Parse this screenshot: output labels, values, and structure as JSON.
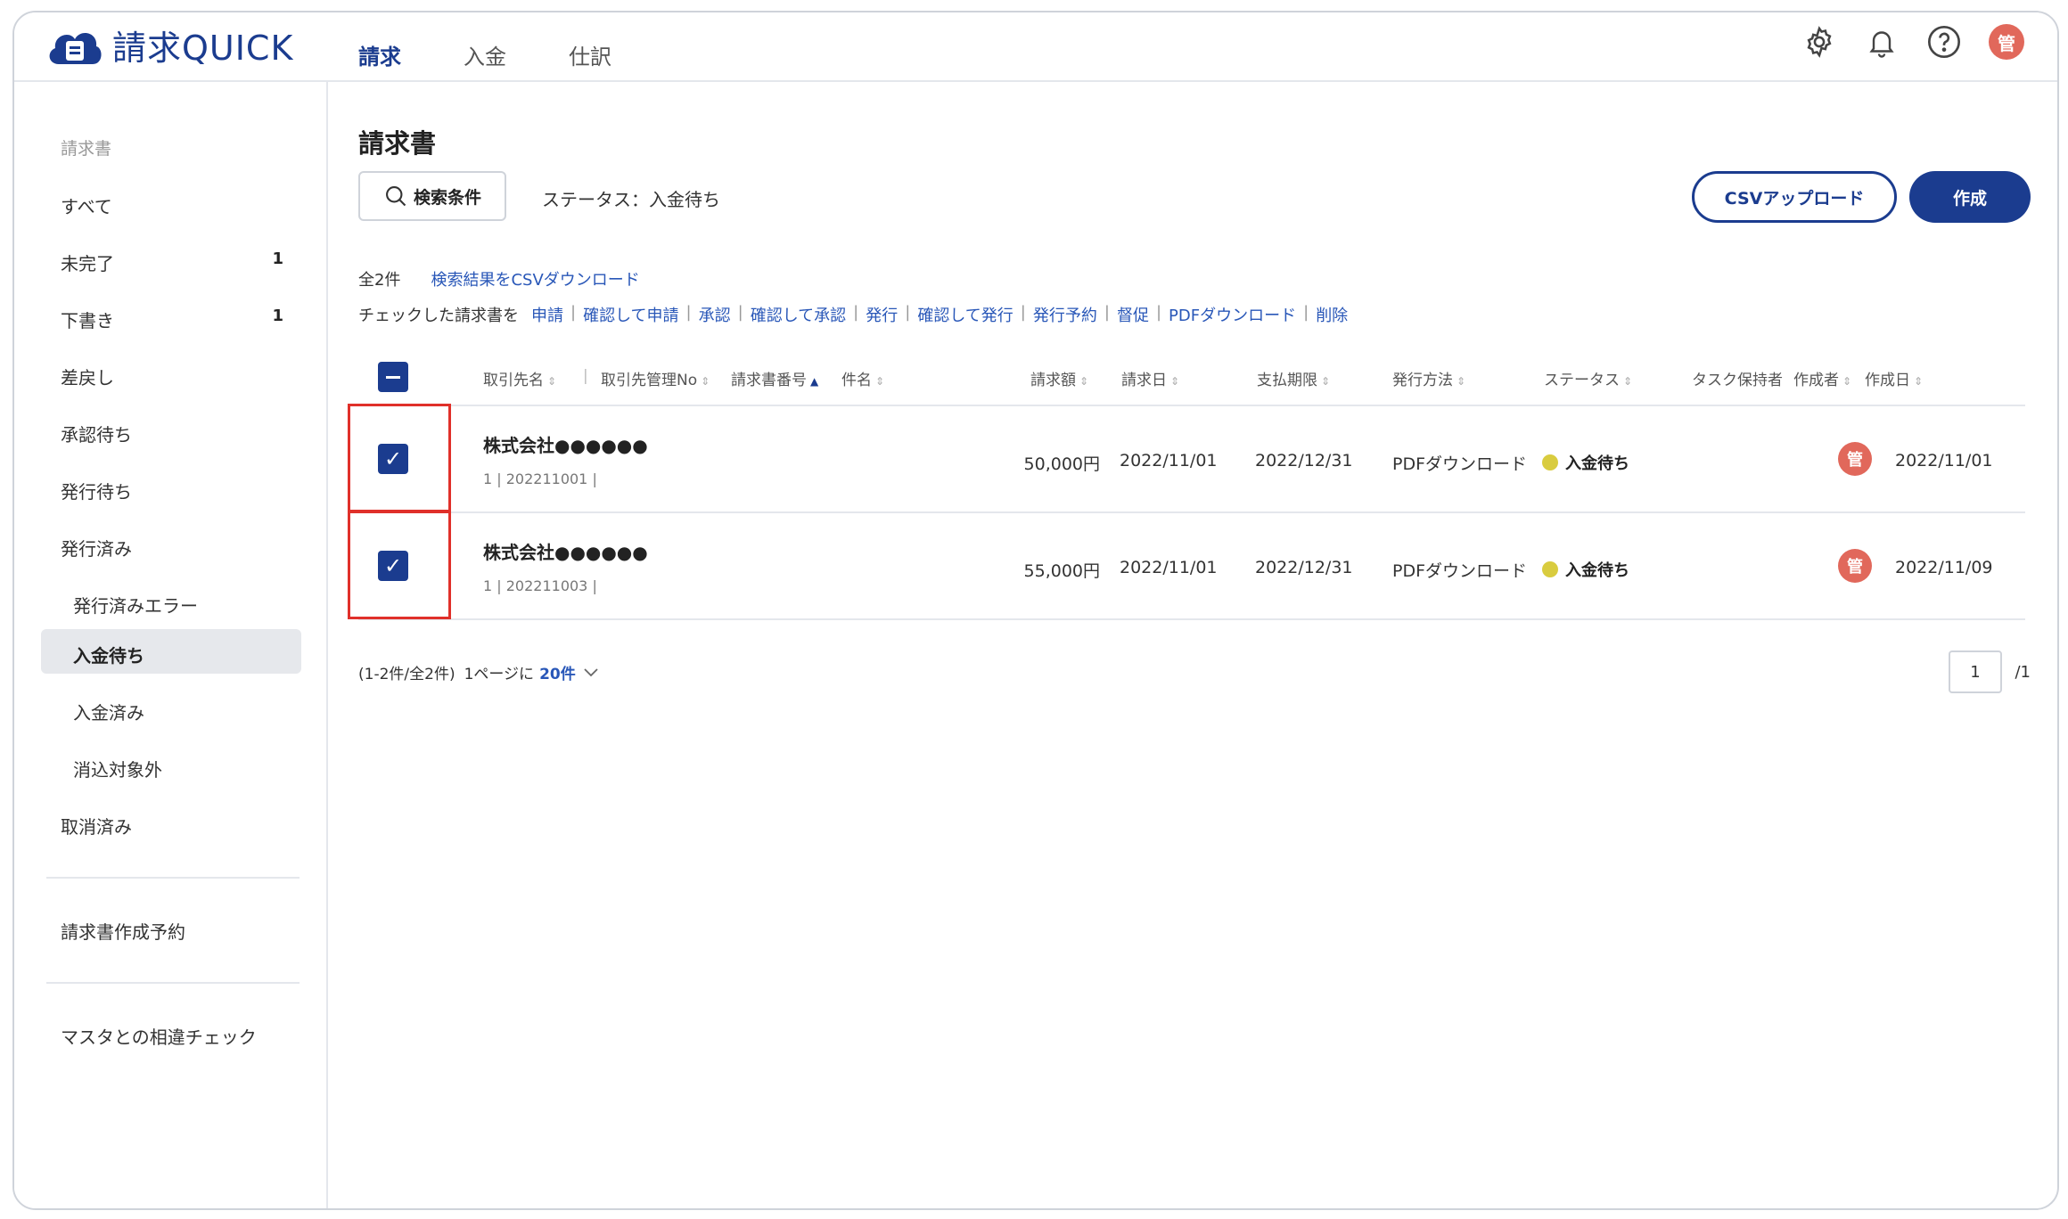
{
  "app": {
    "name": "請求QUICK"
  },
  "nav": {
    "tabs": [
      "請求",
      "入金",
      "仕訳"
    ],
    "active": 0
  },
  "header_icons": [
    "gear-icon",
    "bell-icon",
    "help-icon"
  ],
  "user": {
    "avatar_label": "管"
  },
  "sidebar": {
    "section": "請求書",
    "items": [
      {
        "label": "すべて",
        "count": ""
      },
      {
        "label": "未完了",
        "count": "1"
      },
      {
        "label": "下書き",
        "count": "1"
      },
      {
        "label": "差戻し",
        "count": ""
      },
      {
        "label": "承認待ち",
        "count": ""
      },
      {
        "label": "発行待ち",
        "count": ""
      },
      {
        "label": "発行済み",
        "count": ""
      },
      {
        "label": "発行済みエラー",
        "count": ""
      },
      {
        "label": "入金待ち",
        "count": ""
      },
      {
        "label": "入金済み",
        "count": ""
      },
      {
        "label": "消込対象外",
        "count": ""
      },
      {
        "label": "取消済み",
        "count": ""
      }
    ],
    "active_item": "入金待ち",
    "extra": [
      "請求書作成予約",
      "マスタとの相違チェック"
    ]
  },
  "main": {
    "title": "請求書",
    "search_label": "検索条件",
    "status_filter": "ステータス：入金待ち",
    "csv_upload": "CSVアップロード",
    "create": "作成",
    "total": "全2件",
    "csv_download": "検索結果をCSVダウンロード",
    "actions_prefix": "チェックした請求書を",
    "actions": [
      "申請",
      "確認して申請",
      "承認",
      "確認して承認",
      "発行",
      "確認して発行",
      "発行予約",
      "督促",
      "PDFダウンロード",
      "削除"
    ]
  },
  "table": {
    "columns": {
      "client": "取引先名",
      "client_no": "取引先管理No",
      "invoice_no": "請求書番号",
      "subject": "件名",
      "amount": "請求額",
      "date": "請求日",
      "due": "支払期限",
      "method": "発行方法",
      "status": "ステータス",
      "task": "タスク保持者",
      "creator": "作成者",
      "created": "作成日"
    },
    "rows": [
      {
        "client": "株式会社●●●●●●",
        "meta": "1 | 202211001 |",
        "amount": "50,000円",
        "date": "2022/11/01",
        "due": "2022/12/31",
        "method": "PDFダウンロード",
        "status": "入金待ち",
        "creator": "管",
        "created": "2022/11/01",
        "checked": true
      },
      {
        "client": "株式会社●●●●●●",
        "meta": "1 | 202211003 |",
        "amount": "55,000円",
        "date": "2022/11/01",
        "due": "2022/12/31",
        "method": "PDFダウンロード",
        "status": "入金待ち",
        "creator": "管",
        "created": "2022/11/09",
        "checked": true
      }
    ]
  },
  "pager": {
    "range": "(1-2件/全2件)",
    "per_page_prefix": "1ページに",
    "per_page": "20件",
    "page": "1",
    "total_pages": "/1"
  },
  "colors": {
    "brand": "#1b3c8f",
    "link": "#2957b8",
    "status_waiting": "#d9cc3f",
    "avatar": "#e1685b",
    "highlight": "#e0302a"
  }
}
